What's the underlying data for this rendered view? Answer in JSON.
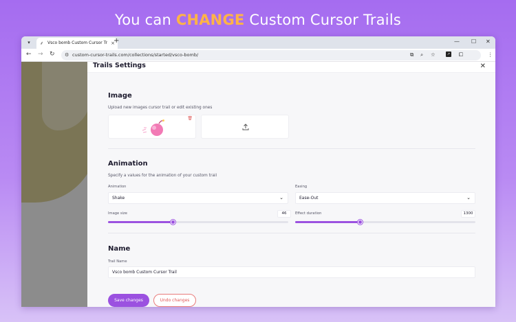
{
  "headline": {
    "prefix": "You can ",
    "highlight": "CHANGE",
    "suffix": " Custom Cursor Trails"
  },
  "browser": {
    "tab_title": "Vsco bomb Custom Cursor Tr",
    "url": "custom-cursor-trails.com/collections/started/vsco-bomb/"
  },
  "panel": {
    "title": "Trails Settings",
    "image": {
      "title": "Image",
      "description": "Upload new images cursor trail or edit existing ones"
    },
    "animation": {
      "title": "Animation",
      "description": "Specify a values for the animation of your custom trail",
      "animation_label": "Animation",
      "animation_value": "Shake",
      "easing_label": "Easing",
      "easing_value": "Ease-Out",
      "image_size_label": "Image size",
      "image_size_value": "46",
      "image_size_fraction": 0.36,
      "effect_duration_label": "Effect duration",
      "effect_duration_value": "1300",
      "effect_duration_fraction": 0.36
    },
    "name": {
      "title": "Name",
      "trail_name_label": "Trail Name",
      "trail_name_value": "Vsco bomb Custom Cursor Trail"
    },
    "buttons": {
      "save": "Save changes",
      "undo": "Undo changes"
    }
  },
  "colors": {
    "accent": "#9b51e0",
    "highlight": "#ffb347",
    "danger": "#e05555"
  }
}
